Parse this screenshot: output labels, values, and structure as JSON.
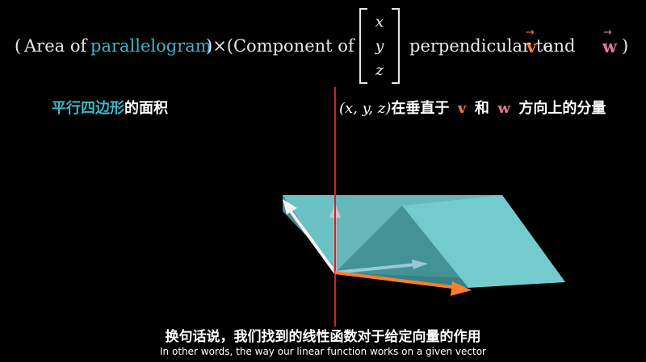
{
  "formula": {
    "open_paren": "(",
    "area_of": "Area of",
    "parallelogram": "parallelogram",
    "close_times": ")×(Component of",
    "vector_entries": [
      "x",
      "y",
      "z"
    ],
    "perpendicular_to": "perpendicular to",
    "v": "v",
    "and": "and",
    "w": "w",
    "close_paren": ")"
  },
  "chinese_labels": {
    "area_highlight": "平行四边形",
    "area_rest": "的面积",
    "component_prefix": "(x, y, z)",
    "component_middle": "在垂直于",
    "v": "v",
    "he": "和",
    "w": "w",
    "component_suffix": "方向上的分量"
  },
  "subtitles": {
    "chinese": "换句话说，我们找到的线性函数对于给定向量的作用",
    "english": "In other words, the way our linear function works on a given vector"
  },
  "colors": {
    "teal": "#3fb6c9",
    "orange": "#ff7f2a",
    "pink": "#e07c92",
    "red_line": "#d61f30",
    "parallelogram_fill": "#6fc7c9"
  }
}
